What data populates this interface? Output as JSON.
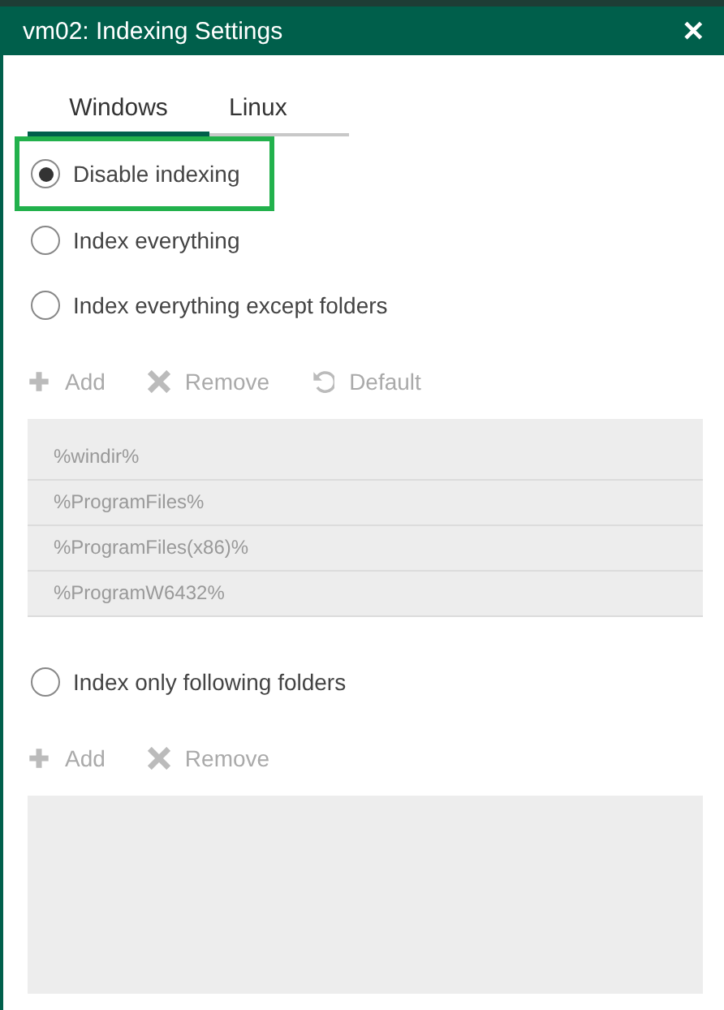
{
  "window": {
    "title": "vm02: Indexing Settings",
    "close": "✕"
  },
  "tabs": [
    {
      "label": "Windows",
      "selected": true
    },
    {
      "label": "Linux",
      "selected": false
    }
  ],
  "options": [
    {
      "label": "Disable indexing",
      "selected": true,
      "highlighted": true
    },
    {
      "label": "Index everything",
      "selected": false,
      "highlighted": false
    },
    {
      "label": "Index everything except folders",
      "selected": false,
      "highlighted": false,
      "kind": "folders",
      "toolbar": [
        {
          "kind": "add",
          "label": "Add",
          "disabled": true
        },
        {
          "kind": "remove",
          "label": "Remove",
          "disabled": true
        },
        {
          "kind": "default",
          "label": "Default",
          "disabled": true
        }
      ],
      "folders": [
        "%windir%",
        "%ProgramFiles%",
        "%ProgramFiles(x86)%",
        "%ProgramW6432%"
      ]
    },
    {
      "label": "Index only following folders",
      "selected": false,
      "highlighted": false,
      "kind": "folders",
      "toolbar": [
        {
          "kind": "add",
          "label": "Add",
          "disabled": true
        },
        {
          "kind": "remove",
          "label": "Remove",
          "disabled": true
        }
      ]
    }
  ]
}
